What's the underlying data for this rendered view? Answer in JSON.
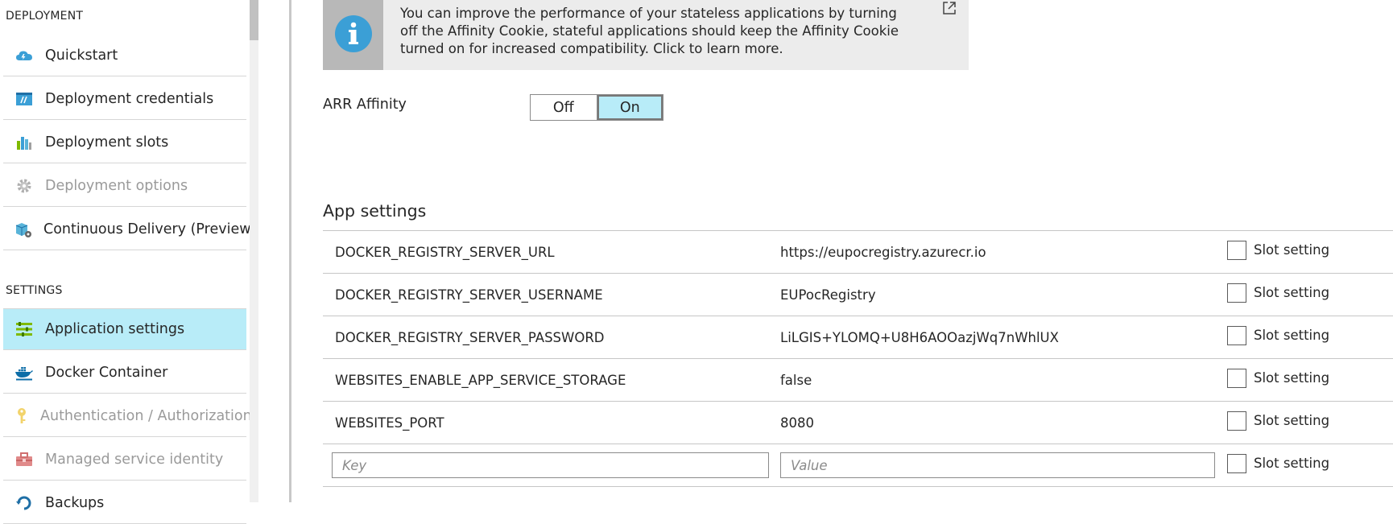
{
  "sidebar": {
    "sections": {
      "deployment": "DEPLOYMENT",
      "settings": "SETTINGS"
    },
    "deployment_items": [
      {
        "label": "Quickstart",
        "icon": "cloud-lightning-icon"
      },
      {
        "label": "Deployment credentials",
        "icon": "credentials-icon"
      },
      {
        "label": "Deployment slots",
        "icon": "slots-icon"
      },
      {
        "label": "Deployment options",
        "icon": "gear-icon",
        "disabled": true
      },
      {
        "label": "Continuous Delivery (Preview)",
        "icon": "delivery-box-icon"
      }
    ],
    "settings_items": [
      {
        "label": "Application settings",
        "icon": "sliders-icon",
        "selected": true
      },
      {
        "label": "Docker Container",
        "icon": "docker-icon"
      },
      {
        "label": "Authentication / Authorization",
        "icon": "key-icon",
        "disabled": true
      },
      {
        "label": "Managed service identity",
        "icon": "toolbox-icon",
        "disabled": true
      },
      {
        "label": "Backups",
        "icon": "backup-icon"
      }
    ]
  },
  "banner": {
    "icon": "info-icon",
    "text": "You can improve the performance of your stateless applications by turning off the Affinity Cookie, stateful applications should keep the Affinity Cookie turned on for increased compatibility. Click to learn more.",
    "external_icon": "external-link-icon"
  },
  "arr_affinity": {
    "label": "ARR Affinity",
    "off_label": "Off",
    "on_label": "On",
    "selected": "On"
  },
  "app_settings": {
    "title": "App settings",
    "slot_label": "Slot setting",
    "rows": [
      {
        "key": "DOCKER_REGISTRY_SERVER_URL",
        "value": "https://eupocregistry.azurecr.io"
      },
      {
        "key": "DOCKER_REGISTRY_SERVER_USERNAME",
        "value": "EUPocRegistry"
      },
      {
        "key": "DOCKER_REGISTRY_SERVER_PASSWORD",
        "value": "LiLGIS+YLOMQ+U8H6AOOazjWq7nWhlUX"
      },
      {
        "key": "WEBSITES_ENABLE_APP_SERVICE_STORAGE",
        "value": "false"
      },
      {
        "key": "WEBSITES_PORT",
        "value": "8080"
      }
    ],
    "new_row": {
      "key_placeholder": "Key",
      "value_placeholder": "Value",
      "key_value": "",
      "value_value": ""
    }
  },
  "colors": {
    "selected_bg": "#b8ecf8",
    "info_blue": "#3b9fd6",
    "banner_bg": "#ececec",
    "banner_icon_bg": "#b8b8b8"
  }
}
